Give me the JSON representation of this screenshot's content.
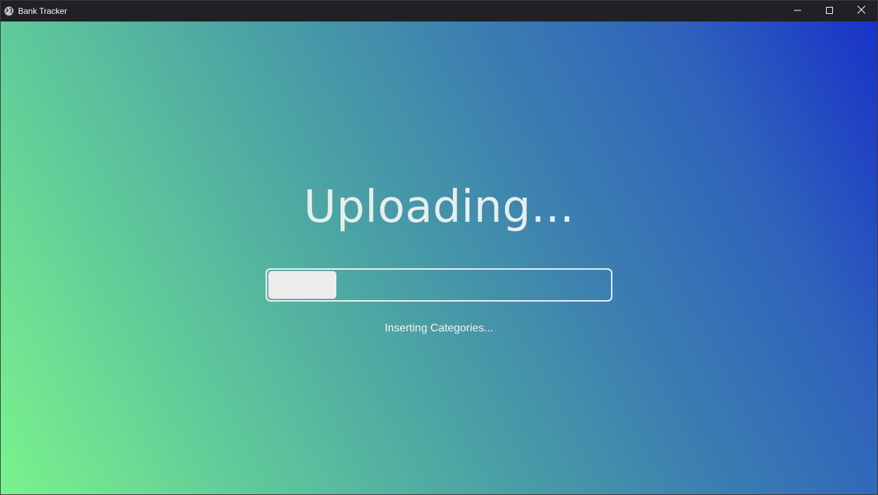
{
  "window": {
    "title": "Bank Tracker",
    "app_icon": "globe-icon",
    "controls": [
      "minimize-icon",
      "maximize-icon",
      "close-icon"
    ]
  },
  "main": {
    "heading": "Uploading...",
    "progress_fraction": 0.2,
    "status": "Inserting Categories..."
  },
  "colors": {
    "titlebar": "#202124",
    "gradient_start": "#7af38c",
    "gradient_end": "#1832c8",
    "progress_fill": "#ececec"
  }
}
